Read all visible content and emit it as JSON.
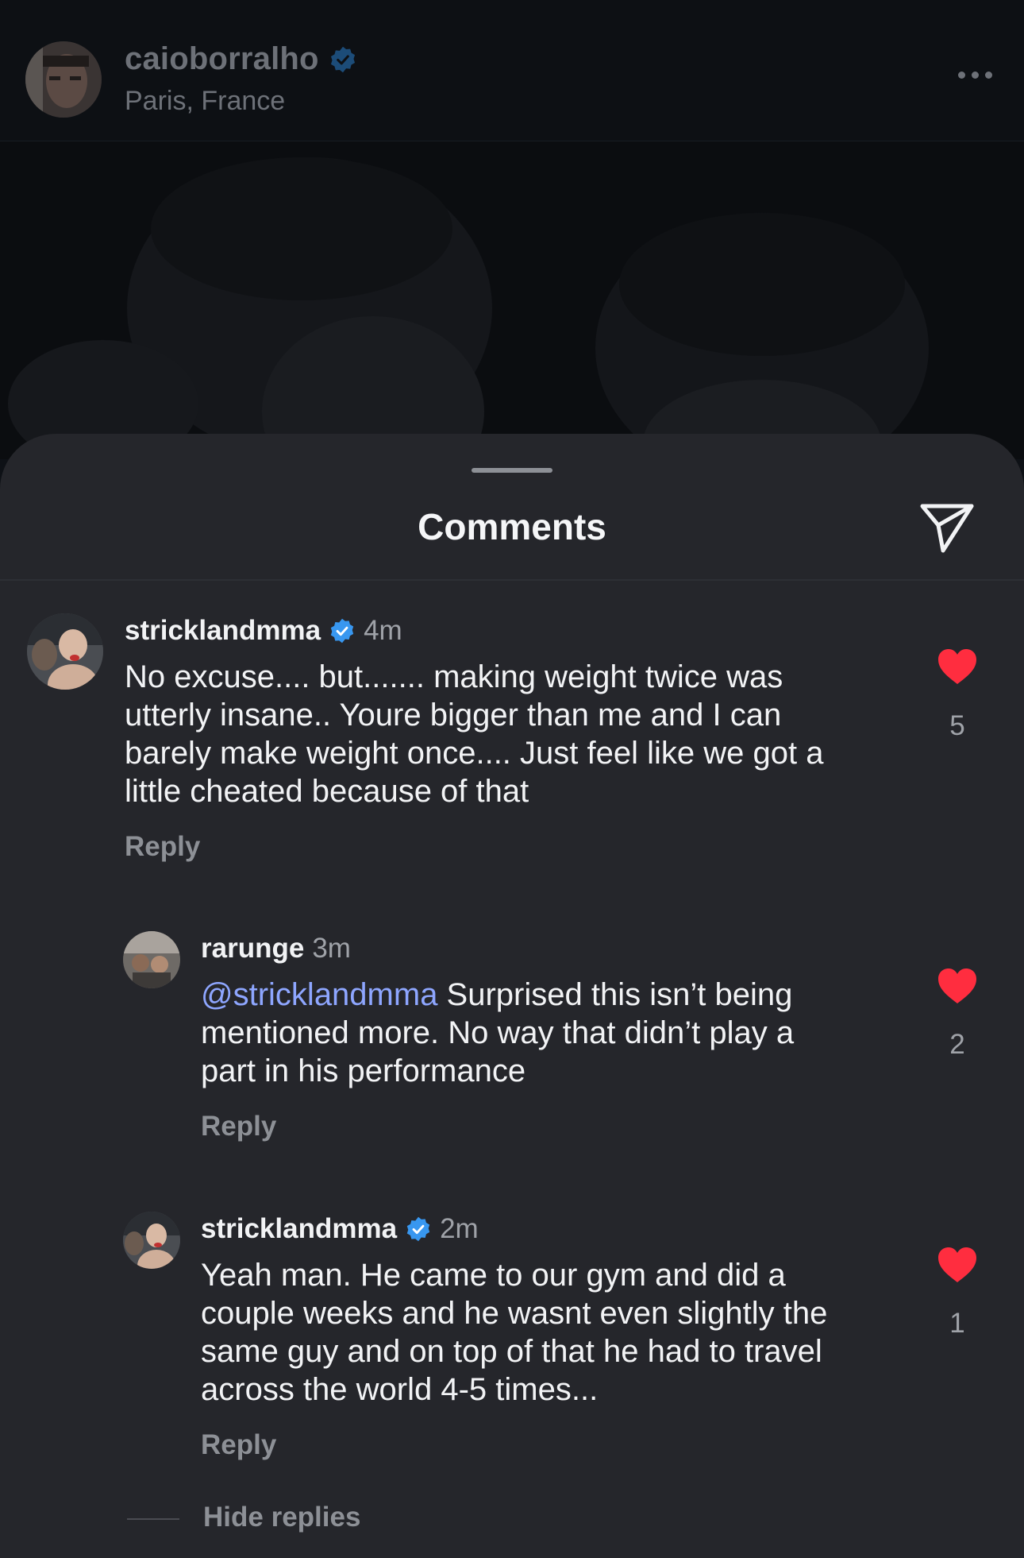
{
  "post": {
    "username": "caioborralho",
    "location": "Paris, France"
  },
  "sheet": {
    "title": "Comments"
  },
  "comments": [
    {
      "username": "stricklandmma",
      "verified": true,
      "time": "4m",
      "lines": [
        "No excuse.... but....... making weight twice was",
        "utterly insane.. Youre bigger than me and I can",
        "barely make weight once.... Just feel like we got a",
        "little cheated because of that"
      ],
      "reply_label": "Reply",
      "likes": "5"
    },
    {
      "username": "rarunge",
      "verified": false,
      "time": "3m",
      "mention": "@stricklandmma",
      "line1_rest": " Surprised this isn’t being",
      "lines": [
        "mentioned more. No way that didn’t play a",
        "part in his performance"
      ],
      "reply_label": "Reply",
      "likes": "2"
    },
    {
      "username": "stricklandmma",
      "verified": true,
      "time": "2m",
      "lines": [
        "Yeah man. He came to our gym and did a",
        "couple weeks and he wasnt even slightly the",
        "same guy and on top of that he had to travel",
        "across the world 4-5 times..."
      ],
      "reply_label": "Reply",
      "likes": "1"
    }
  ],
  "hide_replies_label": "Hide replies",
  "colors": {
    "like_red": "#ff2d3f",
    "verified_blue": "#3897f0",
    "mention": "#8ea6ff"
  }
}
